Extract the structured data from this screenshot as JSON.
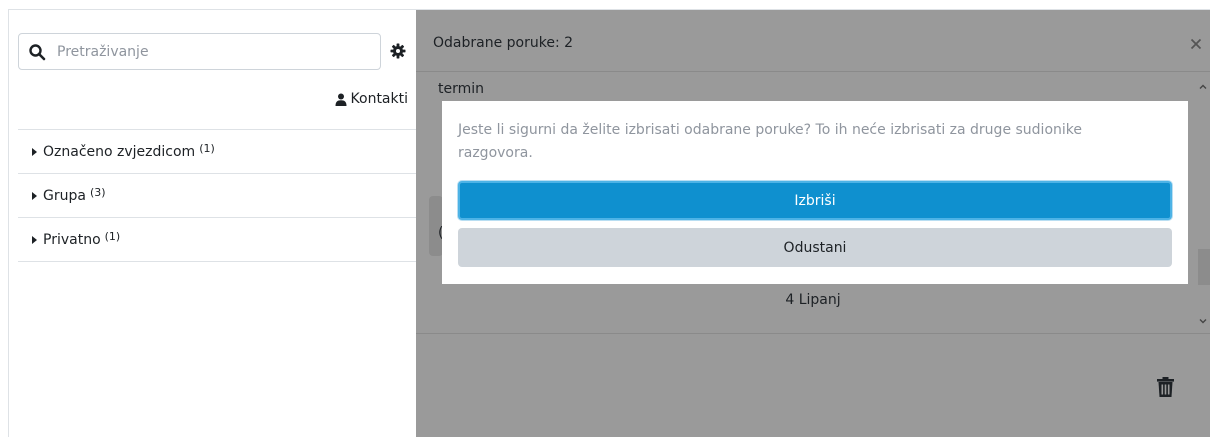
{
  "sidebar": {
    "search_placeholder": "Pretraživanje",
    "contacts_label": "Kontakti",
    "sections": [
      {
        "label": "Označeno zvjezdicom",
        "count": "(1)"
      },
      {
        "label": "Grupa",
        "count": "(3)"
      },
      {
        "label": "Privatno",
        "count": "(1)"
      }
    ]
  },
  "conversation": {
    "header_title": "Odabrane poruke: 2",
    "message_label": "termin",
    "partial_char": "(",
    "date_separator": "4 Lipanj"
  },
  "dialog": {
    "message": "Jeste li sigurni da želite izbrisati odabrane poruke? To ih neće izbrisati za druge sudionike razgovora.",
    "delete_label": "Izbriši",
    "cancel_label": "Odustani"
  },
  "icons": {
    "search": "search-icon",
    "settings": "gear-icon",
    "contacts": "user-icon",
    "close": "close-icon",
    "trash": "trash-icon"
  },
  "colors": {
    "primary": "#0f90cf",
    "secondary": "#ced4da",
    "overlay": "#9a9a9a"
  }
}
